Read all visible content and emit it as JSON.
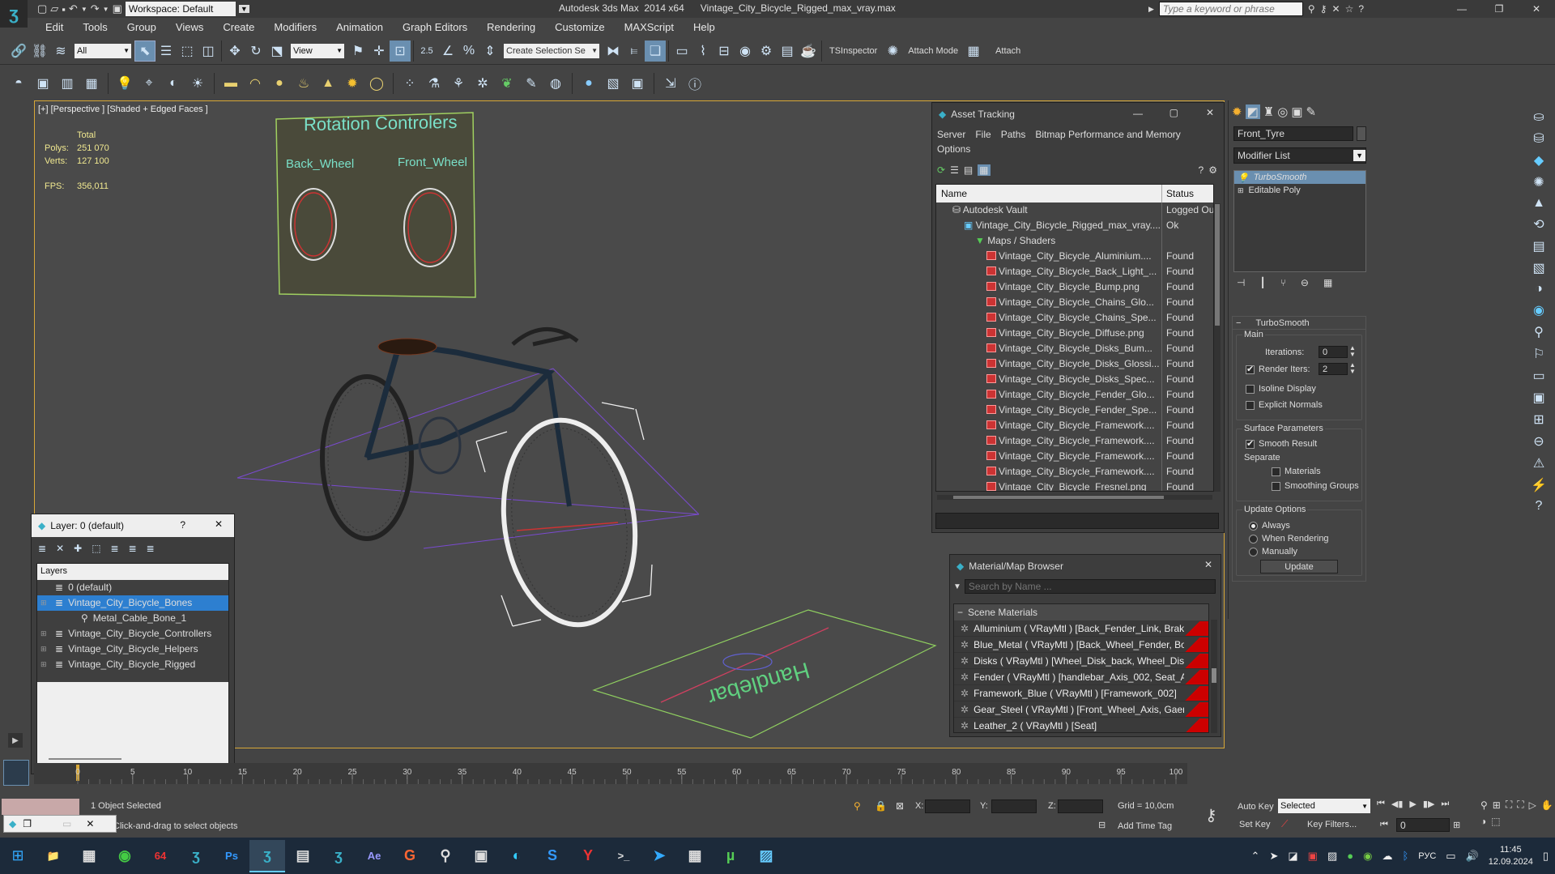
{
  "titlebar": {
    "workspace": "Workspace: Default",
    "title": "Autodesk 3ds Max  2014 x64      Vintage_City_Bicycle_Rigged_max_vray.max",
    "search_placeholder": "Type a keyword or phrase"
  },
  "menu": [
    "Edit",
    "Tools",
    "Group",
    "Views",
    "Create",
    "Modifiers",
    "Animation",
    "Graph Editors",
    "Rendering",
    "Customize",
    "MAXScript",
    "Help"
  ],
  "toolbar1": {
    "filter": "All",
    "refcoord": "View",
    "selset": "Create Selection Se",
    "tsinspector": "TSInspector",
    "attach_mode": "Attach Mode",
    "attach": "Attach",
    "snap": "2.5"
  },
  "viewport": {
    "label": "[+] [Perspective ] [Shaded + Edged Faces ]",
    "stats": {
      "total": "Total",
      "polys_label": "Polys:",
      "polys": "251 070",
      "verts_label": "Verts:",
      "verts": "127 100",
      "fps_label": "FPS:",
      "fps": "356,011"
    },
    "rot_title": "Rotation Controlers",
    "back_wheel": "Back_Wheel",
    "front_wheel": "Front_Wheel",
    "handlebar": "Handlebar"
  },
  "asset": {
    "title": "Asset Tracking",
    "menu": [
      "Server",
      "File",
      "Paths",
      "Bitmap Performance and Memory",
      "Options"
    ],
    "col_name": "Name",
    "col_status": "Status",
    "rows": [
      {
        "name": "Autodesk Vault",
        "status": "Logged Ou",
        "indent": 1
      },
      {
        "name": "Vintage_City_Bicycle_Rigged_max_vray....",
        "status": "Ok",
        "indent": 2
      },
      {
        "name": "Maps / Shaders",
        "status": "",
        "indent": 3
      },
      {
        "name": "Vintage_City_Bicycle_Aluminium....",
        "status": "Found",
        "indent": 4
      },
      {
        "name": "Vintage_City_Bicycle_Back_Light_...",
        "status": "Found",
        "indent": 4
      },
      {
        "name": "Vintage_City_Bicycle_Bump.png",
        "status": "Found",
        "indent": 4
      },
      {
        "name": "Vintage_City_Bicycle_Chains_Glo...",
        "status": "Found",
        "indent": 4
      },
      {
        "name": "Vintage_City_Bicycle_Chains_Spe...",
        "status": "Found",
        "indent": 4
      },
      {
        "name": "Vintage_City_Bicycle_Diffuse.png",
        "status": "Found",
        "indent": 4
      },
      {
        "name": "Vintage_City_Bicycle_Disks_Bum...",
        "status": "Found",
        "indent": 4
      },
      {
        "name": "Vintage_City_Bicycle_Disks_Glossi...",
        "status": "Found",
        "indent": 4
      },
      {
        "name": "Vintage_City_Bicycle_Disks_Spec...",
        "status": "Found",
        "indent": 4
      },
      {
        "name": "Vintage_City_Bicycle_Fender_Glo...",
        "status": "Found",
        "indent": 4
      },
      {
        "name": "Vintage_City_Bicycle_Fender_Spe...",
        "status": "Found",
        "indent": 4
      },
      {
        "name": "Vintage_City_Bicycle_Framework....",
        "status": "Found",
        "indent": 4
      },
      {
        "name": "Vintage_City_Bicycle_Framework....",
        "status": "Found",
        "indent": 4
      },
      {
        "name": "Vintage_City_Bicycle_Framework....",
        "status": "Found",
        "indent": 4
      },
      {
        "name": "Vintage_City_Bicycle_Framework....",
        "status": "Found",
        "indent": 4
      },
      {
        "name": "Vintage_City_Bicycle_Fresnel.png",
        "status": "Found",
        "indent": 4
      }
    ]
  },
  "layer": {
    "title": "Layer: 0 (default)",
    "help": "?",
    "header": "Layers",
    "rows": [
      {
        "name": "0 (default)",
        "indent": 1,
        "sel": false
      },
      {
        "name": "Vintage_City_Bicycle_Bones",
        "indent": 1,
        "sel": true
      },
      {
        "name": "Metal_Cable_Bone_1",
        "indent": 2,
        "sel": false
      },
      {
        "name": "Vintage_City_Bicycle_Controllers",
        "indent": 1,
        "sel": false
      },
      {
        "name": "Vintage_City_Bicycle_Helpers",
        "indent": 1,
        "sel": false
      },
      {
        "name": "Vintage_City_Bicycle_Rigged",
        "indent": 1,
        "sel": false
      }
    ]
  },
  "material": {
    "title": "Material/Map Browser",
    "search_placeholder": "Search by Name ...",
    "section": "Scene Materials",
    "rows": [
      "Alluminium  ( VRayMtl ) [Back_Fender_Link, Brake_...",
      "Blue_Metal  ( VRayMtl ) [Back_Wheel_Fender, Boin...",
      "Disks  ( VRayMtl ) [Wheel_Disk_back, Wheel_Disk_f...",
      "Fender  ( VRayMtl ) [handlebar_Axis_002, Seat_Am...",
      "Framework_Blue  ( VRayMtl ) [Framework_002]",
      "Gear_Steel  ( VRayMtl ) [Front_Wheel_Axis, Gaer_1...",
      "Leather_2  ( VRayMtl ) [Seat]"
    ]
  },
  "cmd": {
    "object_name": "Front_Tyre",
    "modifier_list": "Modifier List",
    "stack": [
      "TurboSmooth",
      "Editable Poly"
    ],
    "rollout": "TurboSmooth",
    "main": "Main",
    "iterations_label": "Iterations:",
    "iterations": "0",
    "render_iters_label": "Render Iters:",
    "render_iters": "2",
    "isoline": "Isoline Display",
    "explicit": "Explicit Normals",
    "surface": "Surface Parameters",
    "smooth_result": "Smooth Result",
    "separate": "Separate",
    "materials": "Materials",
    "smoothing": "Smoothing Groups",
    "update_options": "Update Options",
    "always": "Always",
    "when_rendering": "When Rendering",
    "manually": "Manually",
    "update": "Update"
  },
  "timeline": {
    "range": "0 / 100",
    "ticks": [
      "0",
      "5",
      "10",
      "15",
      "20",
      "25",
      "30",
      "35",
      "40",
      "45",
      "50",
      "55",
      "60",
      "65",
      "70",
      "75",
      "80",
      "85",
      "90",
      "95",
      "100"
    ]
  },
  "status": {
    "selected": "1 Object Selected",
    "prompt": "Click-and-drag to select objects",
    "x": "X:",
    "y": "Y:",
    "z": "Z:",
    "grid": "Grid = 10,0cm",
    "add_time_tag": "Add Time Tag",
    "auto_key": "Auto Key",
    "selected_drop": "Selected",
    "set_key": "Set Key",
    "key_filters": "Key Filters...",
    "frame": "0"
  },
  "taskbar": {
    "lang": "РУС",
    "time": "11:45",
    "date": "12.09.2024",
    "apps": [
      "file-explorer",
      "task-view",
      "chrome",
      "app-64",
      "3dsmax-a",
      "photoshop",
      "3dsmax-active",
      "notepad",
      "3dsmax-b",
      "after-effects",
      "app-g",
      "app-search",
      "app-archive",
      "edge",
      "app-s",
      "yandex",
      "terminal",
      "telegram",
      "calculator",
      "utorrent",
      "app-chart"
    ]
  }
}
